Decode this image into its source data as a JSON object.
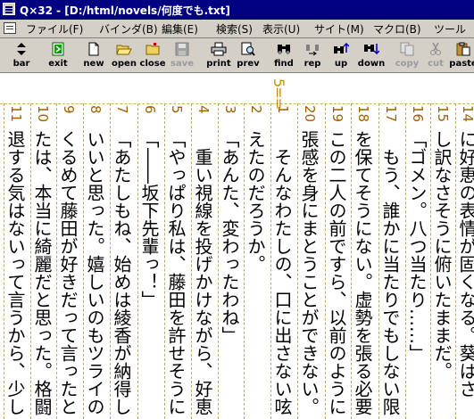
{
  "window": {
    "title": "Q×32 - [D:/html/novels/何度でも.txt]"
  },
  "menubar": {
    "items": [
      {
        "label": "ファイル(F)"
      },
      {
        "label": "バインダ(B)"
      },
      {
        "label": "編集(E)"
      },
      {
        "label": "検索(S)"
      },
      {
        "label": "表示(U)"
      },
      {
        "label": "サイト(M)"
      },
      {
        "label": "マクロ(B)"
      },
      {
        "label": "ツール"
      }
    ]
  },
  "toolbar": {
    "buttons": [
      {
        "label": "bar",
        "icon": "bar-icon",
        "enabled": true
      },
      {
        "label": "exit",
        "icon": "exit-icon",
        "enabled": true
      },
      {
        "label": "new",
        "icon": "new-file-icon",
        "enabled": true
      },
      {
        "label": "open",
        "icon": "open-folder-icon",
        "enabled": true
      },
      {
        "label": "close",
        "icon": "close-folder-icon",
        "enabled": true
      },
      {
        "label": "save",
        "icon": "save-icon",
        "enabled": false
      },
      {
        "label": "print",
        "icon": "print-icon",
        "enabled": true
      },
      {
        "label": "prev",
        "icon": "preview-icon",
        "enabled": true
      },
      {
        "label": "find",
        "icon": "find-icon",
        "enabled": true
      },
      {
        "label": "rep",
        "icon": "replace-icon",
        "enabled": true
      },
      {
        "label": "up",
        "icon": "find-up-icon",
        "enabled": true
      },
      {
        "label": "down",
        "icon": "find-down-icon",
        "enabled": true
      },
      {
        "label": "copy",
        "icon": "copy-icon",
        "enabled": false
      },
      {
        "label": "cut",
        "icon": "cut-icon",
        "enabled": false
      },
      {
        "label": "paste",
        "icon": "paste-icon",
        "enabled": true
      }
    ]
  },
  "ruler": {
    "marker": "5=="
  },
  "editor": {
    "columns": [
      {
        "num": "14",
        "text": "に好恵の表情が固くなる。葵はさ"
      },
      {
        "num": "15",
        "text": "し訳なさそうに俯いたままだ。"
      },
      {
        "num": "16",
        "text": "「ゴメン。八つ当たり……」"
      },
      {
        "num": "17",
        "text": "　もう、誰かに当たりでもしない限"
      },
      {
        "num": "18",
        "text": "を保てそうにない。虚勢を張る必要"
      },
      {
        "num": "19",
        "text": "この二人の前ですら、以前のように"
      },
      {
        "num": "20",
        "text": "張感を身にまとうことができない。"
      },
      {
        "num": "1",
        "text": "　そんなわたしの、口に出さない呟"
      },
      {
        "num": "2",
        "text": "えたのだろうか。"
      },
      {
        "num": "3",
        "text": "「あんた、変わったわね」"
      },
      {
        "num": "4",
        "text": "　重い視線を投げかけながら、好恵"
      },
      {
        "num": "5",
        "text": "「やっぱり私は、藤田を許せそうに"
      },
      {
        "num": "6",
        "text": "「――坂下先輩っ！」"
      },
      {
        "num": "7",
        "text": "「あたしもね、始めは綾香が納得し"
      },
      {
        "num": "8",
        "text": "いいと思った。嬉しいのもツライの"
      },
      {
        "num": "9",
        "text": "くるめて藤田が好きだって言ったと"
      },
      {
        "num": "10",
        "text": "たは、本当に綺麗だと思った。格闘"
      },
      {
        "num": "11",
        "text": "退する気はないって言うから、少し"
      }
    ]
  }
}
